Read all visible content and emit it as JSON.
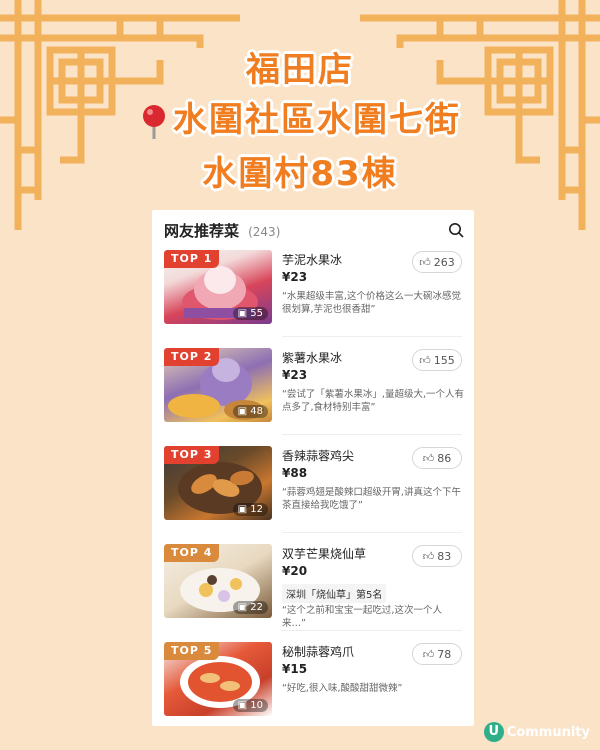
{
  "poster": {
    "line1": "福田店",
    "line2": "水圍社區水圍七街",
    "line3": "水圍村83棟"
  },
  "card": {
    "title": "网友推荐菜",
    "count": "(243)"
  },
  "items": [
    {
      "rank": "TOP 1",
      "name": "芋泥水果冰",
      "price": "¥23",
      "likes": "263",
      "photos": "55",
      "badge": "",
      "review": "“水果超级丰富,这个价格这么一大碗冰感觉很划算,芋泥也很香甜”"
    },
    {
      "rank": "TOP 2",
      "name": "紫薯水果冰",
      "price": "¥23",
      "likes": "155",
      "photos": "48",
      "badge": "",
      "review": "“尝试了「紫薯水果冰」,量超级大,一个人有点多了,食材特别丰富”"
    },
    {
      "rank": "TOP 3",
      "name": "香辣蒜蓉鸡尖",
      "price": "¥88",
      "likes": "86",
      "photos": "12",
      "badge": "",
      "review": "“蒜蓉鸡翅是酸辣口超级开胃,讲真这个下午茶直接给我吃饿了”"
    },
    {
      "rank": "TOP 4",
      "name": "双芋芒果烧仙草",
      "price": "¥20",
      "likes": "83",
      "photos": "22",
      "badge": "深圳「烧仙草」第5名",
      "review": "“这个之前和宝宝一起吃过,这次一个人来…”"
    },
    {
      "rank": "TOP 5",
      "name": "秘制蒜蓉鸡爪",
      "price": "¥15",
      "likes": "78",
      "photos": "10",
      "badge": "",
      "review": "“好吃,很入味,酸酸甜甜微辣”"
    }
  ],
  "watermark": {
    "logo": "U",
    "text": "Community"
  },
  "colors": {
    "background": "#fbe3c8",
    "accent": "#f07d1f",
    "frame": "#f2b25c",
    "rank_top": "#e2412f",
    "rank_other": "#d98a3d"
  }
}
